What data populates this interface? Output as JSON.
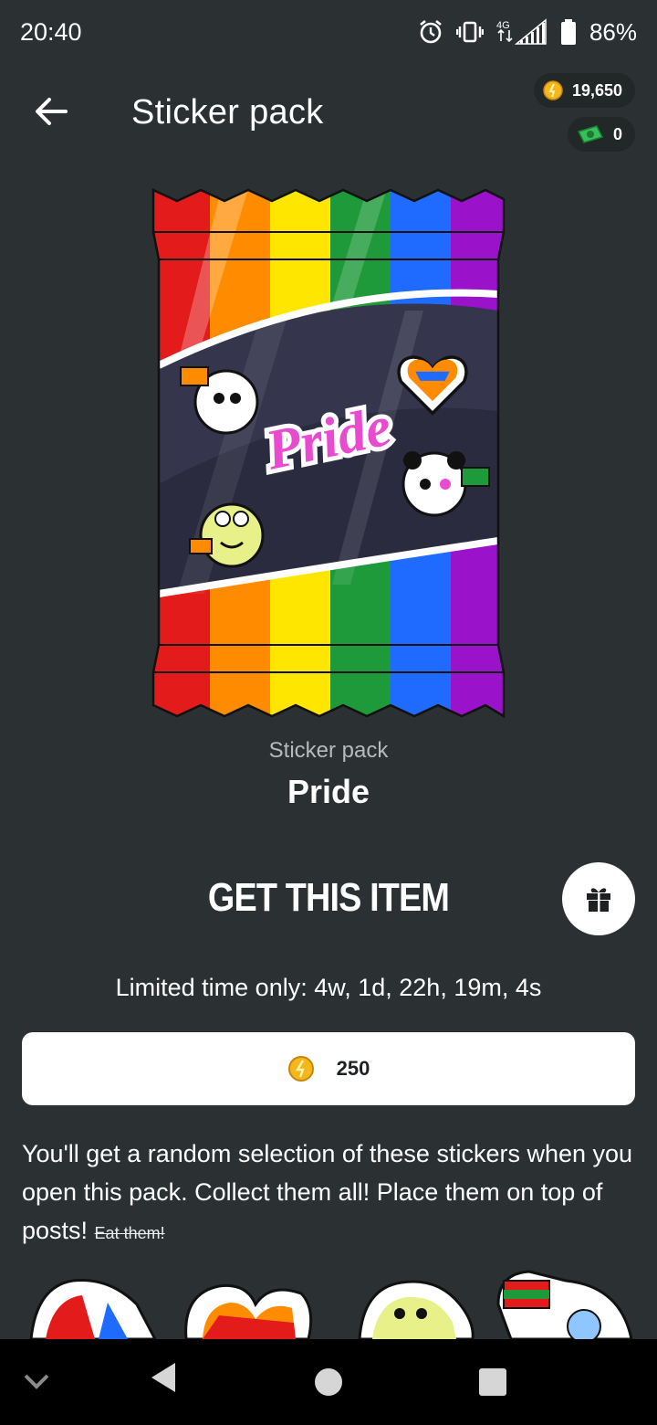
{
  "status_bar": {
    "time": "20:40",
    "network": "4G",
    "battery": "86%"
  },
  "header": {
    "title": "Sticker pack",
    "coins": "19,650",
    "cash": "0"
  },
  "item": {
    "type": "Sticker pack",
    "name": "Pride",
    "pack_art_text": "Pride"
  },
  "purchase": {
    "heading": "GET THIS ITEM",
    "limited_time": "Limited time only: 4w, 1d, 22h, 19m, 4s",
    "price": "250"
  },
  "description": {
    "text": "You'll get a random selection of these stickers when you open this pack. Collect them all! Place them on top of posts! ",
    "strike": "Eat them!"
  },
  "colors": {
    "background": "#2b3132",
    "rainbow": [
      "#e31b1b",
      "#ff8c00",
      "#ffe600",
      "#1f9a3a",
      "#1f6bff",
      "#9a12c9"
    ]
  },
  "icons": [
    "back-arrow-icon",
    "coin-icon",
    "cash-icon",
    "gift-icon",
    "alarm-icon",
    "vibrate-icon",
    "signal-icon",
    "battery-icon"
  ]
}
